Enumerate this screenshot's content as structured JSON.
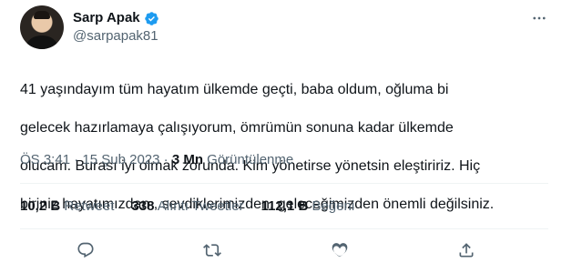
{
  "author": {
    "display_name": "Sarp Apak",
    "handle": "@sarpapak81",
    "verified": true,
    "verified_color": "#1d9bf0"
  },
  "tweet": {
    "text_lines": [
      "41 yaşındayım tüm hayatım ülkemde geçti, baba oldum, oğluma bi",
      "gelecek hazırlamaya çalışıyorum, ömrümün sonuna kadar ülkemde",
      "olucam. Burası iyi olmak zorunda. Kim yönetirse yönetsin eleştiririz. Hiç",
      "biriniz hayatımızdan , sevdiklerimizden, geleceğimizden önemli değilsiniz."
    ]
  },
  "meta": {
    "time": "ÖS 3:41",
    "separator": " · ",
    "date": "15 Şub 2023",
    "views_count": "3 Mn",
    "views_label": "Görüntülenme"
  },
  "stats": {
    "retweets": {
      "count": "10,2 B",
      "label": "Retweet"
    },
    "quotes": {
      "count": "338",
      "label": "Alıntı Tweetler"
    },
    "likes": {
      "count": "112,1 B",
      "label": "Beğeni"
    }
  },
  "actions": {
    "icons": [
      "reply-icon",
      "retweet-icon",
      "like-icon",
      "share-icon",
      "more-icon"
    ]
  },
  "colors": {
    "text": "#0f1419",
    "secondary": "#536471",
    "divider": "#eff3f4"
  }
}
